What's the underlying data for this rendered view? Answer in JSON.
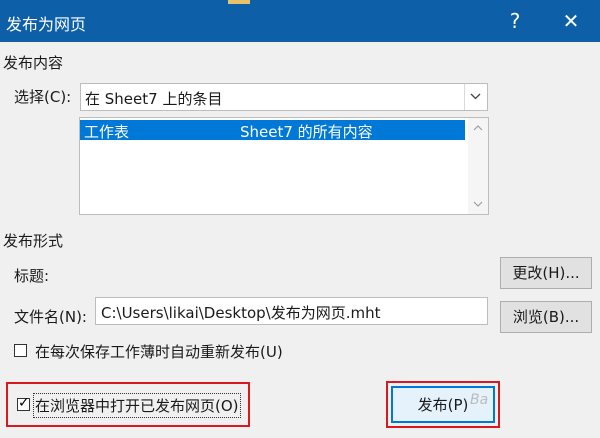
{
  "window": {
    "title": "发布为网页",
    "help_label": "?",
    "close_label": "✕"
  },
  "publish_content": {
    "section_label": "发布内容",
    "select_label": "选择(C):",
    "select_value": "在 Sheet7 上的条目",
    "list_items": [
      {
        "type": "工作表",
        "description": "Sheet7 的所有内容",
        "selected": true
      }
    ]
  },
  "publish_form": {
    "section_label": "发布形式",
    "title_label": "标题:",
    "change_button": "更改(H)...",
    "filename_label": "文件名(N):",
    "filename_value": "C:\\Users\\likai\\Desktop\\发布为网页.mht",
    "browse_button": "浏览(B)...",
    "autorepublish_label": "在每次保存工作薄时自动重新发布(U)",
    "autorepublish_checked": false
  },
  "footer": {
    "open_in_browser_label": "在浏览器中打开已发布网页(O)",
    "open_in_browser_checked": true,
    "publish_button": "发布(P)"
  },
  "watermark_text": "Ba"
}
